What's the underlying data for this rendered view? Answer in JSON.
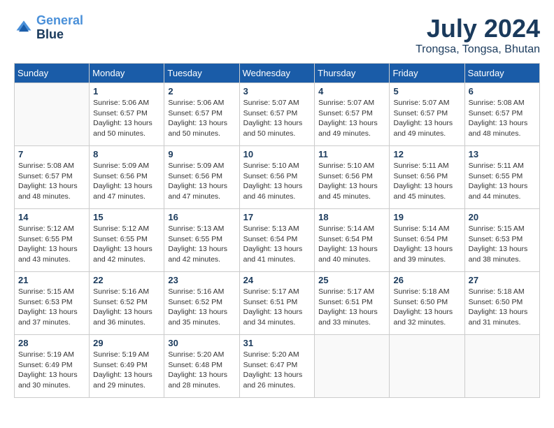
{
  "header": {
    "logo_line1": "General",
    "logo_line2": "Blue",
    "month_year": "July 2024",
    "location": "Trongsa, Tongsa, Bhutan"
  },
  "weekdays": [
    "Sunday",
    "Monday",
    "Tuesday",
    "Wednesday",
    "Thursday",
    "Friday",
    "Saturday"
  ],
  "weeks": [
    [
      {
        "day": "",
        "sunrise": "",
        "sunset": "",
        "daylight": ""
      },
      {
        "day": "1",
        "sunrise": "Sunrise: 5:06 AM",
        "sunset": "Sunset: 6:57 PM",
        "daylight": "Daylight: 13 hours and 50 minutes."
      },
      {
        "day": "2",
        "sunrise": "Sunrise: 5:06 AM",
        "sunset": "Sunset: 6:57 PM",
        "daylight": "Daylight: 13 hours and 50 minutes."
      },
      {
        "day": "3",
        "sunrise": "Sunrise: 5:07 AM",
        "sunset": "Sunset: 6:57 PM",
        "daylight": "Daylight: 13 hours and 50 minutes."
      },
      {
        "day": "4",
        "sunrise": "Sunrise: 5:07 AM",
        "sunset": "Sunset: 6:57 PM",
        "daylight": "Daylight: 13 hours and 49 minutes."
      },
      {
        "day": "5",
        "sunrise": "Sunrise: 5:07 AM",
        "sunset": "Sunset: 6:57 PM",
        "daylight": "Daylight: 13 hours and 49 minutes."
      },
      {
        "day": "6",
        "sunrise": "Sunrise: 5:08 AM",
        "sunset": "Sunset: 6:57 PM",
        "daylight": "Daylight: 13 hours and 48 minutes."
      }
    ],
    [
      {
        "day": "7",
        "sunrise": "Sunrise: 5:08 AM",
        "sunset": "Sunset: 6:57 PM",
        "daylight": "Daylight: 13 hours and 48 minutes."
      },
      {
        "day": "8",
        "sunrise": "Sunrise: 5:09 AM",
        "sunset": "Sunset: 6:56 PM",
        "daylight": "Daylight: 13 hours and 47 minutes."
      },
      {
        "day": "9",
        "sunrise": "Sunrise: 5:09 AM",
        "sunset": "Sunset: 6:56 PM",
        "daylight": "Daylight: 13 hours and 47 minutes."
      },
      {
        "day": "10",
        "sunrise": "Sunrise: 5:10 AM",
        "sunset": "Sunset: 6:56 PM",
        "daylight": "Daylight: 13 hours and 46 minutes."
      },
      {
        "day": "11",
        "sunrise": "Sunrise: 5:10 AM",
        "sunset": "Sunset: 6:56 PM",
        "daylight": "Daylight: 13 hours and 45 minutes."
      },
      {
        "day": "12",
        "sunrise": "Sunrise: 5:11 AM",
        "sunset": "Sunset: 6:56 PM",
        "daylight": "Daylight: 13 hours and 45 minutes."
      },
      {
        "day": "13",
        "sunrise": "Sunrise: 5:11 AM",
        "sunset": "Sunset: 6:55 PM",
        "daylight": "Daylight: 13 hours and 44 minutes."
      }
    ],
    [
      {
        "day": "14",
        "sunrise": "Sunrise: 5:12 AM",
        "sunset": "Sunset: 6:55 PM",
        "daylight": "Daylight: 13 hours and 43 minutes."
      },
      {
        "day": "15",
        "sunrise": "Sunrise: 5:12 AM",
        "sunset": "Sunset: 6:55 PM",
        "daylight": "Daylight: 13 hours and 42 minutes."
      },
      {
        "day": "16",
        "sunrise": "Sunrise: 5:13 AM",
        "sunset": "Sunset: 6:55 PM",
        "daylight": "Daylight: 13 hours and 42 minutes."
      },
      {
        "day": "17",
        "sunrise": "Sunrise: 5:13 AM",
        "sunset": "Sunset: 6:54 PM",
        "daylight": "Daylight: 13 hours and 41 minutes."
      },
      {
        "day": "18",
        "sunrise": "Sunrise: 5:14 AM",
        "sunset": "Sunset: 6:54 PM",
        "daylight": "Daylight: 13 hours and 40 minutes."
      },
      {
        "day": "19",
        "sunrise": "Sunrise: 5:14 AM",
        "sunset": "Sunset: 6:54 PM",
        "daylight": "Daylight: 13 hours and 39 minutes."
      },
      {
        "day": "20",
        "sunrise": "Sunrise: 5:15 AM",
        "sunset": "Sunset: 6:53 PM",
        "daylight": "Daylight: 13 hours and 38 minutes."
      }
    ],
    [
      {
        "day": "21",
        "sunrise": "Sunrise: 5:15 AM",
        "sunset": "Sunset: 6:53 PM",
        "daylight": "Daylight: 13 hours and 37 minutes."
      },
      {
        "day": "22",
        "sunrise": "Sunrise: 5:16 AM",
        "sunset": "Sunset: 6:52 PM",
        "daylight": "Daylight: 13 hours and 36 minutes."
      },
      {
        "day": "23",
        "sunrise": "Sunrise: 5:16 AM",
        "sunset": "Sunset: 6:52 PM",
        "daylight": "Daylight: 13 hours and 35 minutes."
      },
      {
        "day": "24",
        "sunrise": "Sunrise: 5:17 AM",
        "sunset": "Sunset: 6:51 PM",
        "daylight": "Daylight: 13 hours and 34 minutes."
      },
      {
        "day": "25",
        "sunrise": "Sunrise: 5:17 AM",
        "sunset": "Sunset: 6:51 PM",
        "daylight": "Daylight: 13 hours and 33 minutes."
      },
      {
        "day": "26",
        "sunrise": "Sunrise: 5:18 AM",
        "sunset": "Sunset: 6:50 PM",
        "daylight": "Daylight: 13 hours and 32 minutes."
      },
      {
        "day": "27",
        "sunrise": "Sunrise: 5:18 AM",
        "sunset": "Sunset: 6:50 PM",
        "daylight": "Daylight: 13 hours and 31 minutes."
      }
    ],
    [
      {
        "day": "28",
        "sunrise": "Sunrise: 5:19 AM",
        "sunset": "Sunset: 6:49 PM",
        "daylight": "Daylight: 13 hours and 30 minutes."
      },
      {
        "day": "29",
        "sunrise": "Sunrise: 5:19 AM",
        "sunset": "Sunset: 6:49 PM",
        "daylight": "Daylight: 13 hours and 29 minutes."
      },
      {
        "day": "30",
        "sunrise": "Sunrise: 5:20 AM",
        "sunset": "Sunset: 6:48 PM",
        "daylight": "Daylight: 13 hours and 28 minutes."
      },
      {
        "day": "31",
        "sunrise": "Sunrise: 5:20 AM",
        "sunset": "Sunset: 6:47 PM",
        "daylight": "Daylight: 13 hours and 26 minutes."
      },
      {
        "day": "",
        "sunrise": "",
        "sunset": "",
        "daylight": ""
      },
      {
        "day": "",
        "sunrise": "",
        "sunset": "",
        "daylight": ""
      },
      {
        "day": "",
        "sunrise": "",
        "sunset": "",
        "daylight": ""
      }
    ]
  ]
}
